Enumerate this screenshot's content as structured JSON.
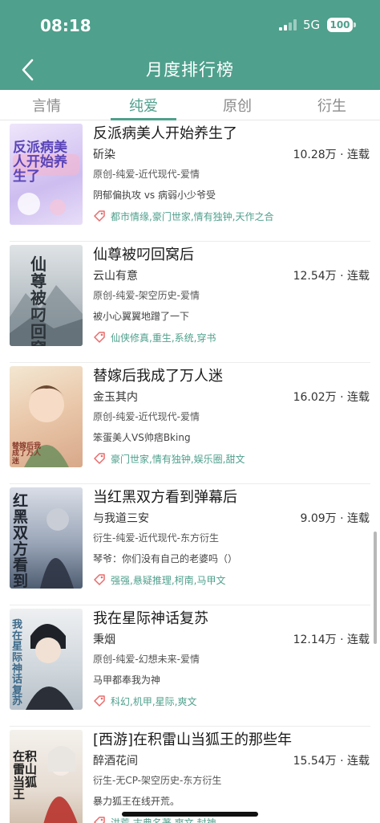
{
  "status_bar": {
    "time": "08:18",
    "network": "5G",
    "battery": "100"
  },
  "nav": {
    "title": "月度排行榜",
    "back_icon": "chevron-left-icon"
  },
  "tabs": [
    {
      "label": "言情",
      "active": false
    },
    {
      "label": "纯爱",
      "active": true
    },
    {
      "label": "原创",
      "active": false
    },
    {
      "label": "衍生",
      "active": false
    }
  ],
  "books": [
    {
      "title": "反派病美人开始养生了",
      "author": "斫染",
      "stats": "10.28万 · 连载",
      "category": "原创-纯爱-近代现代-爱情",
      "blurb": "阴郁偏执攻 vs 病弱小少爷受",
      "tags": "都市情缘,豪门世家,情有独钟,天作之合",
      "cover_text": "反派病美人开始养生了"
    },
    {
      "title": "仙尊被叼回窝后",
      "author": "云山有意",
      "stats": "12.54万 · 连载",
      "category": "原创-纯爱-架空历史-爱情",
      "blurb": "被小心翼翼地蹭了一下",
      "tags": "仙侠修真,重生,系统,穿书",
      "cover_text": "仙尊被叼回窝后"
    },
    {
      "title": "替嫁后我成了万人迷",
      "author": "金玉其内",
      "stats": "16.02万 · 连载",
      "category": "原创-纯爱-近代现代-爱情",
      "blurb": "笨蛋美人VS帅痞Bking",
      "tags": "豪门世家,情有独钟,娱乐圈,甜文",
      "cover_text": "替嫁后我成了万人迷"
    },
    {
      "title": "当红黑双方看到弹幕后",
      "author": "与我道三安",
      "stats": "9.09万 · 连载",
      "category": "衍生-纯爱-近代现代-东方衍生",
      "blurb": "琴爷：你们没有自己的老婆吗（）",
      "tags": "强强,悬疑推理,柯南,马甲文",
      "cover_text": "红黑双方看到弹幕后"
    },
    {
      "title": "我在星际神话复苏",
      "author": "秉烟",
      "stats": "12.14万 · 连载",
      "category": "原创-纯爱-幻想未来-爱情",
      "blurb": "马甲都奉我为神",
      "tags": "科幻,机甲,星际,爽文",
      "cover_text": "我在星际神话复苏"
    },
    {
      "title": "[西游]在积雷山当狐王的那些年",
      "author": "醉酒花间",
      "stats": "15.54万 · 连载",
      "category": "衍生-无CP-架空历史-东方衍生",
      "blurb": "暴力狐王在线开荒。",
      "tags": "洪荒,古典名著,爽文,封神",
      "cover_text": "在积雷山当狐王"
    }
  ],
  "colors": {
    "accent": "#4fa08c",
    "tag_icon": "#e86b6b"
  }
}
